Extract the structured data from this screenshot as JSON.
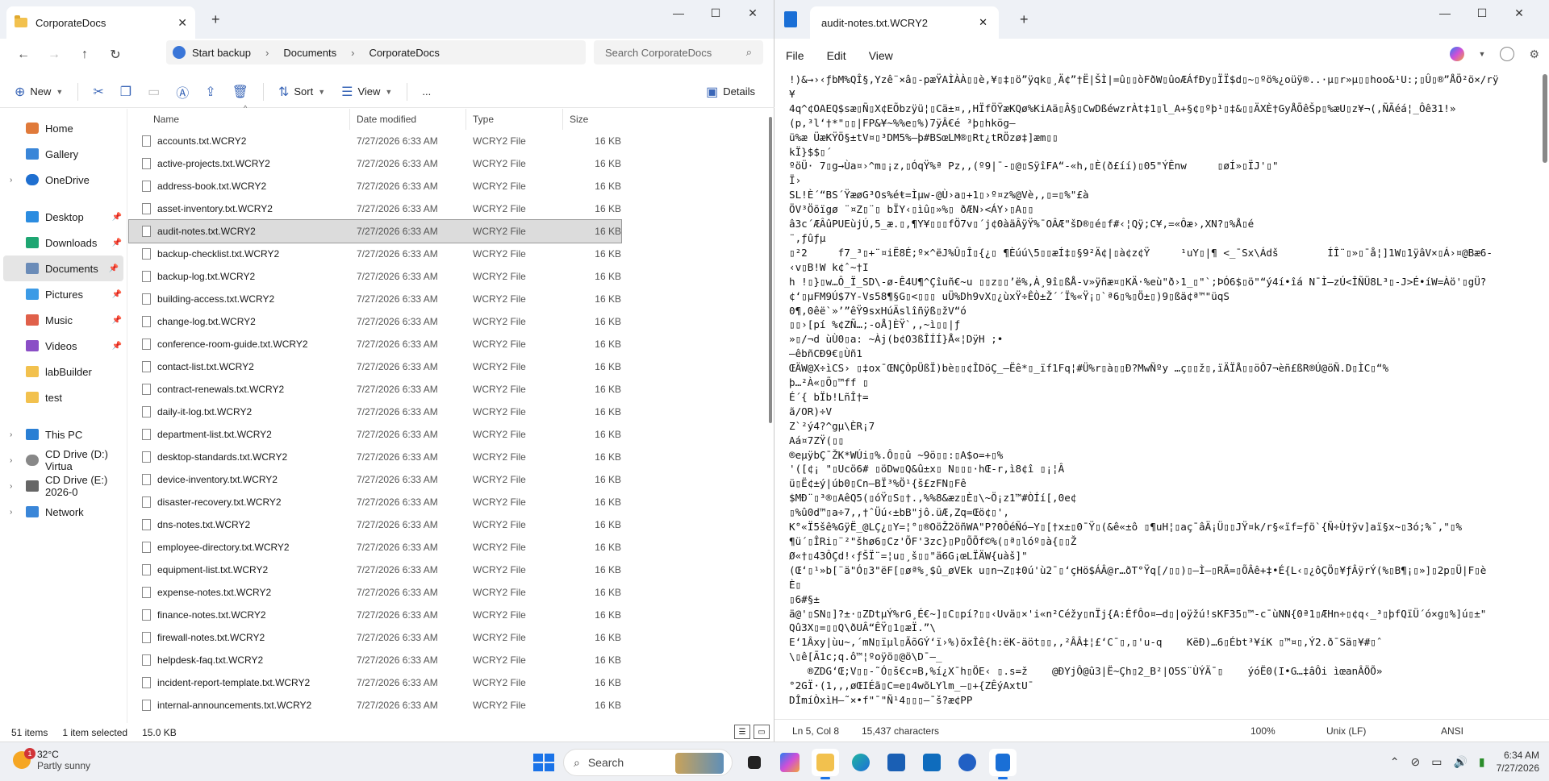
{
  "explorer": {
    "tab_title": "CorporateDocs",
    "address": {
      "start_backup": "Start backup",
      "crumbs": [
        "Documents",
        "CorporateDocs"
      ]
    },
    "search_placeholder": "Search CorporateDocs",
    "toolbar": {
      "new": "New",
      "sort": "Sort",
      "view": "View",
      "more": "...",
      "details": "Details"
    },
    "nav": {
      "home": "Home",
      "gallery": "Gallery",
      "onedrive": "OneDrive",
      "desktop": "Desktop",
      "downloads": "Downloads",
      "documents": "Documents",
      "pictures": "Pictures",
      "music": "Music",
      "videos": "Videos",
      "labbuilder": "labBuilder",
      "test": "test",
      "thispc": "This PC",
      "cd_d": "CD Drive (D:) Virtua",
      "cd_e": "CD Drive (E:) 2026-0",
      "network": "Network"
    },
    "columns": {
      "name": "Name",
      "date": "Date modified",
      "type": "Type",
      "size": "Size"
    },
    "files": [
      {
        "name": "accounts.txt.WCRY2",
        "date": "7/27/2026 6:33 AM",
        "type": "WCRY2 File",
        "size": "16 KB"
      },
      {
        "name": "active-projects.txt.WCRY2",
        "date": "7/27/2026 6:33 AM",
        "type": "WCRY2 File",
        "size": "16 KB"
      },
      {
        "name": "address-book.txt.WCRY2",
        "date": "7/27/2026 6:33 AM",
        "type": "WCRY2 File",
        "size": "16 KB"
      },
      {
        "name": "asset-inventory.txt.WCRY2",
        "date": "7/27/2026 6:33 AM",
        "type": "WCRY2 File",
        "size": "16 KB"
      },
      {
        "name": "audit-notes.txt.WCRY2",
        "date": "7/27/2026 6:33 AM",
        "type": "WCRY2 File",
        "size": "16 KB"
      },
      {
        "name": "backup-checklist.txt.WCRY2",
        "date": "7/27/2026 6:33 AM",
        "type": "WCRY2 File",
        "size": "16 KB"
      },
      {
        "name": "backup-log.txt.WCRY2",
        "date": "7/27/2026 6:33 AM",
        "type": "WCRY2 File",
        "size": "16 KB"
      },
      {
        "name": "building-access.txt.WCRY2",
        "date": "7/27/2026 6:33 AM",
        "type": "WCRY2 File",
        "size": "16 KB"
      },
      {
        "name": "change-log.txt.WCRY2",
        "date": "7/27/2026 6:33 AM",
        "type": "WCRY2 File",
        "size": "16 KB"
      },
      {
        "name": "conference-room-guide.txt.WCRY2",
        "date": "7/27/2026 6:33 AM",
        "type": "WCRY2 File",
        "size": "16 KB"
      },
      {
        "name": "contact-list.txt.WCRY2",
        "date": "7/27/2026 6:33 AM",
        "type": "WCRY2 File",
        "size": "16 KB"
      },
      {
        "name": "contract-renewals.txt.WCRY2",
        "date": "7/27/2026 6:33 AM",
        "type": "WCRY2 File",
        "size": "16 KB"
      },
      {
        "name": "daily-it-log.txt.WCRY2",
        "date": "7/27/2026 6:33 AM",
        "type": "WCRY2 File",
        "size": "16 KB"
      },
      {
        "name": "department-list.txt.WCRY2",
        "date": "7/27/2026 6:33 AM",
        "type": "WCRY2 File",
        "size": "16 KB"
      },
      {
        "name": "desktop-standards.txt.WCRY2",
        "date": "7/27/2026 6:33 AM",
        "type": "WCRY2 File",
        "size": "16 KB"
      },
      {
        "name": "device-inventory.txt.WCRY2",
        "date": "7/27/2026 6:33 AM",
        "type": "WCRY2 File",
        "size": "16 KB"
      },
      {
        "name": "disaster-recovery.txt.WCRY2",
        "date": "7/27/2026 6:33 AM",
        "type": "WCRY2 File",
        "size": "16 KB"
      },
      {
        "name": "dns-notes.txt.WCRY2",
        "date": "7/27/2026 6:33 AM",
        "type": "WCRY2 File",
        "size": "16 KB"
      },
      {
        "name": "employee-directory.txt.WCRY2",
        "date": "7/27/2026 6:33 AM",
        "type": "WCRY2 File",
        "size": "16 KB"
      },
      {
        "name": "equipment-list.txt.WCRY2",
        "date": "7/27/2026 6:33 AM",
        "type": "WCRY2 File",
        "size": "16 KB"
      },
      {
        "name": "expense-notes.txt.WCRY2",
        "date": "7/27/2026 6:33 AM",
        "type": "WCRY2 File",
        "size": "16 KB"
      },
      {
        "name": "finance-notes.txt.WCRY2",
        "date": "7/27/2026 6:33 AM",
        "type": "WCRY2 File",
        "size": "16 KB"
      },
      {
        "name": "firewall-notes.txt.WCRY2",
        "date": "7/27/2026 6:33 AM",
        "type": "WCRY2 File",
        "size": "16 KB"
      },
      {
        "name": "helpdesk-faq.txt.WCRY2",
        "date": "7/27/2026 6:33 AM",
        "type": "WCRY2 File",
        "size": "16 KB"
      },
      {
        "name": "incident-report-template.txt.WCRY2",
        "date": "7/27/2026 6:33 AM",
        "type": "WCRY2 File",
        "size": "16 KB"
      },
      {
        "name": "internal-announcements.txt.WCRY2",
        "date": "7/27/2026 6:33 AM",
        "type": "WCRY2 File",
        "size": "16 KB"
      }
    ],
    "selected_index": 4,
    "status": {
      "items": "51 items",
      "selected": "1 item selected",
      "size": "15.0 KB"
    }
  },
  "notepad": {
    "tab_title": "audit-notes.txt.WCRY2",
    "menu": {
      "file": "File",
      "edit": "Edit",
      "view": "View"
    },
    "content": "!)&→›‹ƒbM%QÎ§,Yzê¨×â▯-pæŸAÌÀÀ▯▯è,¥▯‡▯ö”ÿqk▯¸Ä¢”†Ë|ŠÌ|=û▯▯òFðW▯ûoÆÁfÐy▯ÏÏ$d▯~▯ºö%¿oüÿ®..·µ▯r»µ▯▯hoo&¹U:;▯Û▯®”ÅÖ²ö×/rÿ\n¥\n4q^¢OAEQ$sæ▯Ñ▯X¢EÕbzÿü¦▯Cä±¤,,HÏfÖŸæKQø%KiAä▯Â§▯CwDßéwzrÀt‡1▯l_A+§¢▯ºþ¹▯‡&▯▯ÄXÈ†GyÅÕêŠp▯%æU▯z¥¬(,ÑÃéá¦_Ôê31!»\n(p,³l‘†*\"▯▯|FP&¥~%%e▯%)7ÿÂ€é ³þ▯hkög–\nü%æ ÜæKŸÖ§±tV¤▯³DM5%–þ#BSœLM®▯Rt¿tRÖzø‡]æm▯▯\nkÏ}$$▯´\nºöÜ· 7▯g→Ùa¤›^m▯¡z,▯ÓqŸ%ª Pz,,(º9|¯-▯@▯SÿîFA“-«h,▯È(ð£íí)▯05\"ÝÊnw     ▯øÍ»▯ÏJ'▯\"\nÏ›\nSL!È´“BS´ŸæøG³Os%éŧ=Ìµw-@Ù›a▯+1▯›º¤z%@Vè,,▯=▯%\"£à\nÖV³Öõïgø ¨¤Z▯¨▯ bÏY‹▯ìû▯»%▯ ðÆN›<ÁY›▯A▯▯\nâ3c´ÆÂûPUEùjÚ,5_æ.▯,¶Y¥▯▯▯fÖ7v▯´j¢0àäÂÿŸ%¯OÂÆ\"šD®▯é▯f#‹¦Qÿ;C¥,=«Ôæ›,XN?▯%Å▯é\n¨,ƒûƒµ\n▯²2     f7_³▯+¨¤iË8É;º×^ëJ%Û▯Î▯{¿▯ ¶Èúú\\5▯▯æÍ‡▯§9²Ä¢|▯à¢z¢Ÿ     ¹uY▯|¶ <_¯Sx\\Ádš        ÍÎ¨▯»▯¯å¦]1W▯1ÿâV×▯Á›¤@Bæ6-\n‹v▯B!W k¢ˆ~†I\nh !▯}▯w…Ô_Ï_SD\\-ø-Ê4U¶^Çîuñ€~u ▯▯z▯▯’ë%,À¸9î▯ßÅ-v»ÿñæ¤▯KÄ·%eù\"ð›1_▯\"`;ÞÓ6$▯ö\"“ý4í•îá N¯Ì–zÚ<ÎÑÜ8L³▯-J>É•íW=Àö'▯gÜ?\n¢‘▯µFM9Ú$7Y-Vs58¶§G▯<▯▯▯ uÜ%Dh9vX▯¿ùxŸ÷ÊÒ±Ž´´Ï%«Ÿ¡▯`ª6▯%▯Ö±▯)9▯ßä¢ª™\"üqS\n0¶,0êë`»’”êŸ9sxHúÄslîñÿß▯žV“ó\n▯▯›[pí %¢ZÑ…;-oÅ]ÈŸ`,,~ì▯▯|ƒ\n»▯/¬d ùÙ0▯a: ~Àj(b¢O3ßÎÍÍ}Å«¦DÿH ;•\n–êbñCÐ9€▯Ùñ1\nŒÄW@X÷ìCS› ▯‡ox¯ŒNÇÒpÜßÏ)bè▯▯¢ÎDöÇ_–Ëê*▯_ïf1Fq¦#Ü%r▯à▯▯Ð?MwÑºy …ç▯▯ž▯,ïÄÏÅ▯▯öÔ7¬èñ£ßR®Ú@öÑ.D▯ÌC▯“%\nþ…²À«▯Õ▯™ff ▯\nÉ´{ bÏb!LñÎ†=\nã/OR)÷V\nZ`²ý4?^gµ\\ÈR¡7\nAá¤7ZŸ(▯▯\n®eµÿbÇ¯ŽK*WÚi▯%.Ô▯▯û ~9ö▯▯:▯A$o=+▯%\n'([¢¡ \"▯Ucö6# ▯öDw▯Q&û±x▯ N▯▯▯·hŒ-r,ì8¢î ▯¡¦Â\nü▯Ë¢±ý|úb0▯Cn–BÏ³%Ö¹{š£zFN▯Fê\n$MÐ¨▯³®▯AêQ5(▯óŸ▯S▯†.,%%8&æz▯È▯\\~Ö¡z1™#ÒÍí[,0e¢\n▯%û0d™▯a÷7,,†ˆÜú‹±bB\"jô.üÆ,Zq=Œö¢▯',\nK°«Ï5šê%GÿË_@LÇ¿▯Y=¦°▯®OöŽ2öñWA\"P?0ÔéÑó–Y▯[†x±▯0¯Ÿ▯(&ê«±ô ▯¶uH¦▯aç¯âÄ¡Ü▯▯JŸ¤k/r§«ïf=ƒö`{Ñ÷Ù†ÿv]aï§x~▯3ó;%¯,\"▯%\n¶ü´▯ÎRi▯¨²\"šhø6▯Cz'ÕF'3zc}▯P▯ÕÕf©%(▯ª▯lóº▯à{▯▯Ž\nØ«†▯43ÔÇd!‹ƒŠÏ¨=¦u▯¸š▯▯\"ä6G¡œLÏÄW{uàš]\"\n(Œ‘▯¹»b[¨ä\"Ó▯3\"ëF[▯øª%¸$û_øVEk u▯n¬Z▯‡0ú'ù2¯▯‘çHö$ÁÂ@r…ðT°Ÿq[/▯▯)▯–Ì–▯RÃ=▯ÕÂê+‡•É{L‹▯¿ôÇÖ▯¥ƒÂÿrÝ(%▯B¶¡▯»]▯2p▯Ü|F▯è\nÈ▯\n▯6#§±\nä@'▯SN▯]?±·▯ZDtµÝ%rG¸É€~]▯C▯pí?▯▯‹Uvä▯×'i«n²Céžy▯nÏj{A:ÉfÔo¤–d▯|oÿžú!sKF35▯™-c¯ùNN{0ª1▯ÆHn÷▯¢q‹_³▯þfQïÜ´ó×g▯%]ú▯±\"\nQû3X▯=▯▯Q\\ðUÂ“ÊŸ▯1▯æÏ.”\\\nE‘1Âxy|ùu~,´mN▯ïµl▯ÃõGÝ‘ï›%)õxÎê{h:ëK-äöt▯▯,,²ÂÂ‡¦£‘C¯▯,▯'u-q    KëÐ)…6▯Ébt³¥íK ▯™¤▯,Ý2.ð¯Sä▯¥#▯ˆ\n\\▯ê[Ã1c;q.ô™¦ºoÿö▯@ö\\D¯–_\n   ®ZDG‘Œ;V▯▯-˜Ó▯š€c¤B,%í¿X¯h▯ÖE‹ ▯.s=ž    @ÐYjÔ@û3|Ë~Çh▯2_B²|O5S¨ÙÝÄ¯▯    ýóË0(I•G…‡âÔi ìœanÂÖÕ»\n°2GÏ·(1,,,øŒIÉã▯C=e▯4wõLYlm_–▯+{ZÊýAxtU¯\nDÎmíÒxìH–˜×•f\"¯\"Ñ¹4▯▯▯–¯š?æ¢PP",
    "status": {
      "pos": "Ln 5, Col 8",
      "chars": "15,437 characters",
      "zoom": "100%",
      "eol": "Unix (LF)",
      "enc": "ANSI"
    }
  },
  "taskbar": {
    "weather_temp": "32°C",
    "weather_desc": "Partly sunny",
    "weather_badge": "1",
    "search": "Search",
    "time": "6:34 AM",
    "date": "7/27/2026"
  }
}
